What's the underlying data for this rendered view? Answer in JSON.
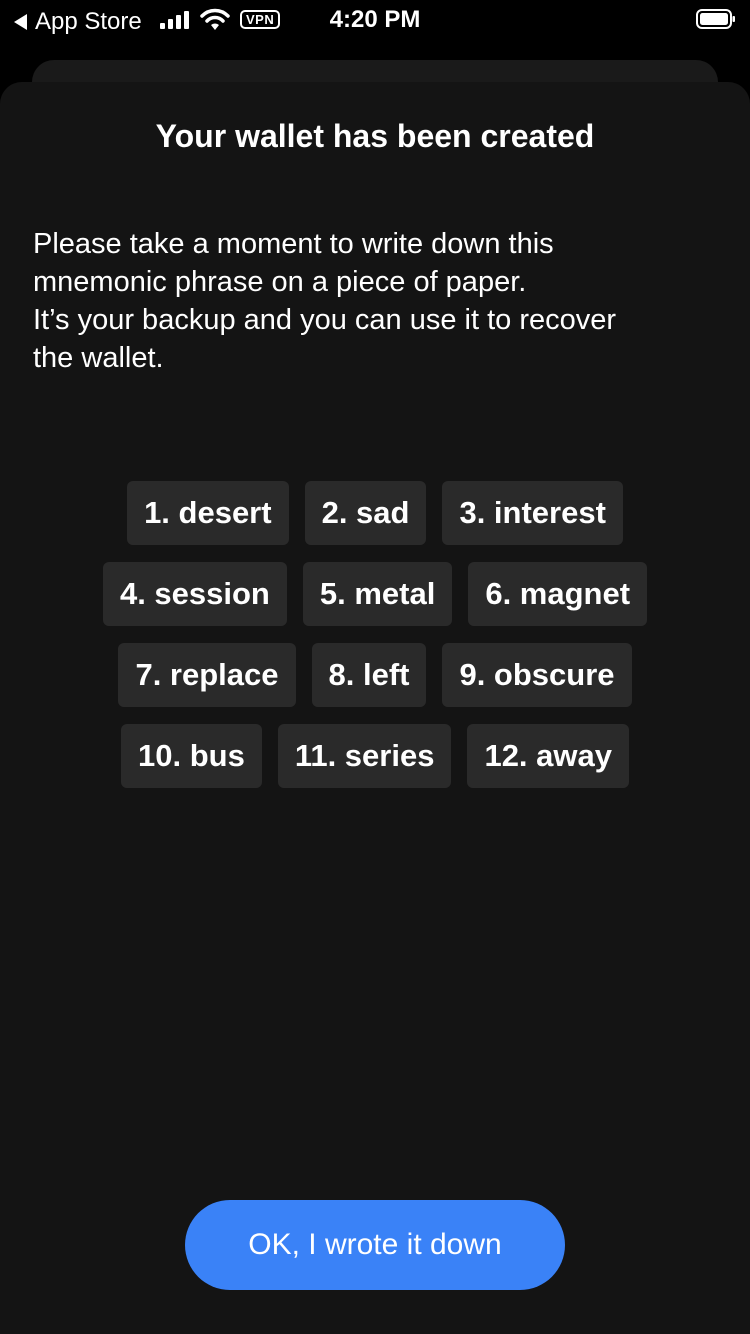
{
  "status_bar": {
    "back_app": "App Store",
    "vpn": "VPN",
    "time": "4:20 PM",
    "battery_level": 1.0
  },
  "sheet": {
    "title": "Your wallet has been created",
    "message_lines": [
      "Please take a moment to write down this",
      "mnemonic phrase on a piece of paper.",
      "It’s your backup and you can use it to recover",
      "the wallet."
    ],
    "words": [
      [
        "1. desert",
        "2. sad",
        "3. interest"
      ],
      [
        "4. session",
        "5. metal",
        "6. magnet"
      ],
      [
        "7. replace",
        "8. left",
        "9. obscure"
      ],
      [
        "10. bus",
        "11. series",
        "12. away"
      ]
    ],
    "confirm_button": "OK, I wrote it down"
  },
  "colors": {
    "background": "#000000",
    "sheet": "#141414",
    "chip": "#2a2a2a",
    "accent": "#3a82f7",
    "text": "#ffffff"
  }
}
